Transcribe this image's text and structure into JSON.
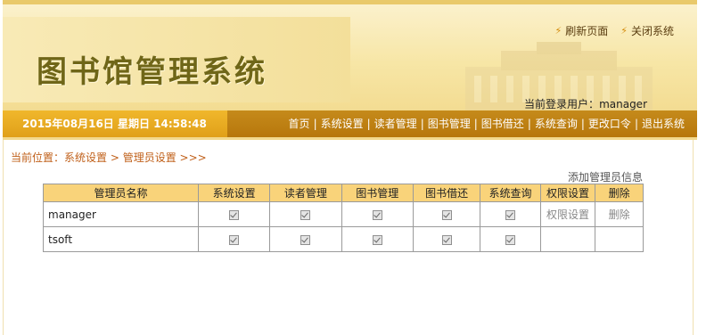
{
  "header": {
    "title": "图书馆管理系统",
    "top_links": [
      {
        "label": "刷新页面",
        "icon": "bolt-icon"
      },
      {
        "label": "关闭系统",
        "icon": "bolt-icon"
      }
    ],
    "login_label": "当前登录用户：",
    "login_user": "manager"
  },
  "navbar": {
    "datetime": "2015年08月16日 星期日 14:58:48",
    "items": [
      "首页",
      "系统设置",
      "读者管理",
      "图书管理",
      "图书借还",
      "系统查询",
      "更改口令",
      "退出系统"
    ]
  },
  "breadcrumb": {
    "prefix": "当前位置：",
    "level1": "系统设置",
    "arrow1": " > ",
    "level2": "管理员设置",
    "suffix": " >>>"
  },
  "add_link": "添加管理员信息",
  "table": {
    "headers": [
      "管理员名称",
      "系统设置",
      "读者管理",
      "图书管理",
      "图书借还",
      "系统查询",
      "权限设置",
      "删除"
    ],
    "rows": [
      {
        "name": "manager",
        "perms": [
          true,
          true,
          true,
          true,
          true
        ],
        "set_perm": "权限设置",
        "delete": "删除"
      },
      {
        "name": "tsoft",
        "perms": [
          true,
          true,
          true,
          true,
          true
        ],
        "set_perm": "",
        "delete": ""
      }
    ]
  },
  "colors": {
    "accent_orange": "#b7770c",
    "date_bg": "#e0a019",
    "table_header": "#f9d37a",
    "breadcrumb": "#c0601a"
  }
}
